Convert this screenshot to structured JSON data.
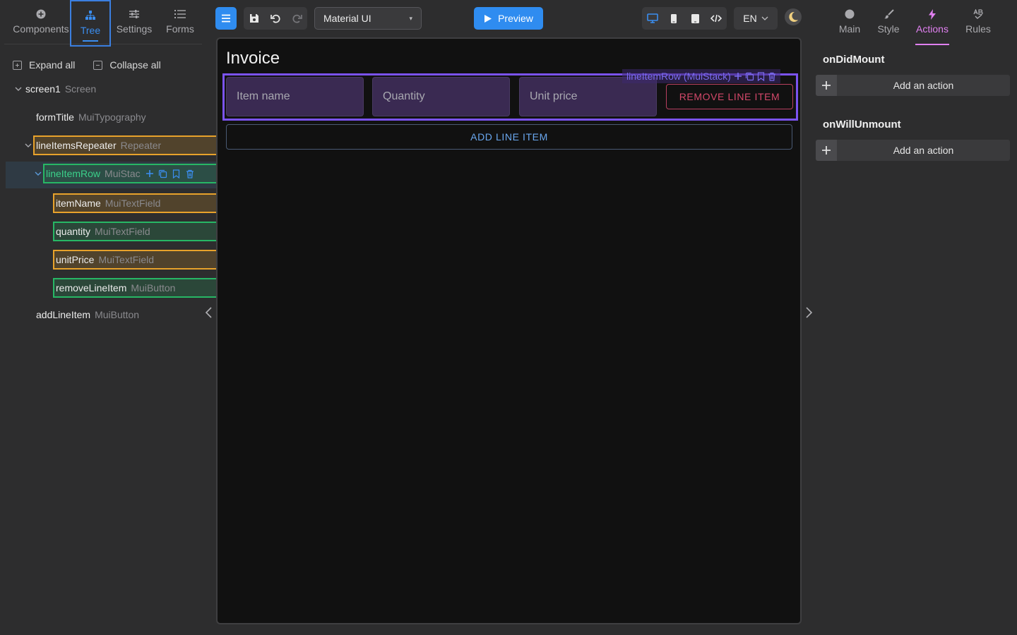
{
  "left_tabs": [
    {
      "label": "Components",
      "icon": "plus-circle-icon"
    },
    {
      "label": "Tree",
      "icon": "tree-icon"
    },
    {
      "label": "Settings",
      "icon": "sliders-icon"
    },
    {
      "label": "Forms",
      "icon": "list-icon"
    }
  ],
  "tree_controls": {
    "expand_all": "Expand all",
    "collapse_all": "Collapse all"
  },
  "tree": [
    {
      "name": "screen1",
      "type": "Screen"
    },
    {
      "name": "formTitle",
      "type": "MuiTypography"
    },
    {
      "name": "lineItemsRepeater",
      "type": "Repeater"
    },
    {
      "name": "lineItemRow",
      "type": "MuiStac"
    },
    {
      "name": "itemName",
      "type": "MuiTextField"
    },
    {
      "name": "quantity",
      "type": "MuiTextField"
    },
    {
      "name": "unitPrice",
      "type": "MuiTextField"
    },
    {
      "name": "removeLineItem",
      "type": "MuiButton"
    },
    {
      "name": "addLineItem",
      "type": "MuiButton"
    }
  ],
  "toolbar": {
    "library": "Material UI",
    "preview_label": "Preview",
    "language": "EN"
  },
  "canvas": {
    "title": "Invoice",
    "stack_label": "lineItemRow (MuiStack)",
    "fields": [
      "Item name",
      "Quantity",
      "Unit price"
    ],
    "remove_label": "REMOVE LINE ITEM",
    "add_label": "ADD LINE ITEM"
  },
  "right_tabs": [
    {
      "label": "Main",
      "icon": "circle-icon"
    },
    {
      "label": "Style",
      "icon": "brush-icon"
    },
    {
      "label": "Actions",
      "icon": "bolt-icon"
    },
    {
      "label": "Rules",
      "icon": "rules-icon"
    }
  ],
  "events": [
    {
      "title": "onDidMount",
      "action_label": "Add an action"
    },
    {
      "title": "onWillUnmount",
      "action_label": "Add an action"
    }
  ],
  "colors": {
    "accent_blue": "#2f8cf0",
    "actions_pink": "#e080f0",
    "highlight_orange": "#e8a22b",
    "highlight_green": "#27b765",
    "stack_purple": "#7b53f0",
    "remove_red": "#d4486a"
  }
}
